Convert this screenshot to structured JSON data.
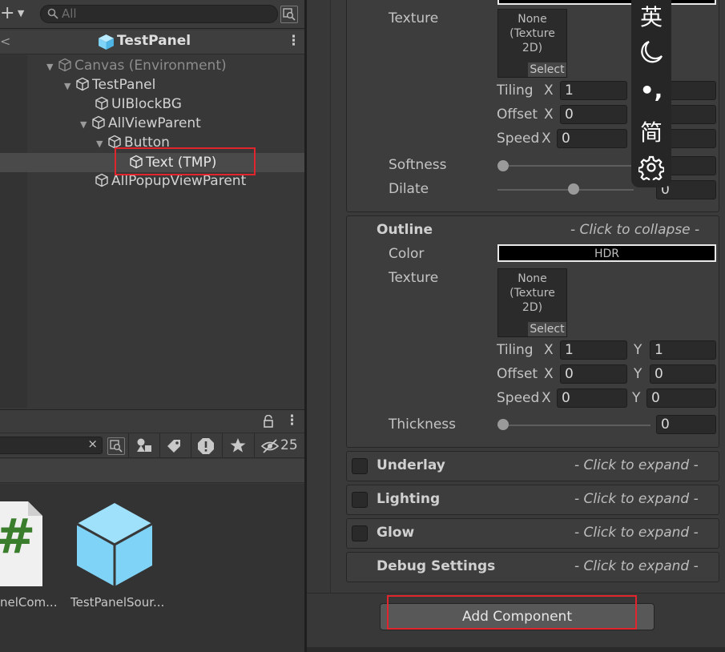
{
  "hierarchy": {
    "search_placeholder": "All",
    "scene_title": "TestPanel",
    "tree": [
      {
        "label": "Canvas (Environment)",
        "dim": true
      },
      {
        "label": "TestPanel"
      },
      {
        "label": "UIBlockBG"
      },
      {
        "label": "AllViewParent"
      },
      {
        "label": "Button"
      },
      {
        "label": "Text (TMP)",
        "selected": true
      },
      {
        "label": "AllPopupViewParent"
      }
    ]
  },
  "project": {
    "hidden_count": "25",
    "assets": [
      {
        "label": "nelCom...",
        "icon": "csharp-script-icon",
        "glyph": "#"
      },
      {
        "label": "TestPanelSour...",
        "icon": "prefab-cube-icon"
      }
    ]
  },
  "inspector": {
    "face": {
      "texture_label": "Texture",
      "texture_none": "None",
      "texture_type": "(Texture",
      "texture_dim": "2D)",
      "select_label": "Select",
      "tiling_label": "Tiling",
      "offset_label": "Offset",
      "speed_label": "Speed",
      "x": "X",
      "tiling_x": "1",
      "offset_x": "0",
      "speed_x": "0",
      "softness_label": "Softness",
      "dilate_label": "Dilate",
      "dilate_value": "0"
    },
    "outline": {
      "title": "Outline",
      "hint": "- Click to collapse -",
      "color_label": "Color",
      "hdr": "HDR",
      "texture_label": "Texture",
      "texture_none": "None",
      "texture_type": "(Texture",
      "texture_dim": "2D)",
      "select_label": "Select",
      "tiling_label": "Tiling",
      "offset_label": "Offset",
      "speed_label": "Speed",
      "x": "X",
      "y": "Y",
      "tiling_x": "1",
      "tiling_y": "1",
      "offset_x": "0",
      "offset_y": "0",
      "speed_x": "0",
      "speed_y": "0",
      "thickness_label": "Thickness",
      "thickness_value": "0"
    },
    "sections": [
      {
        "title": "Underlay",
        "hint": "- Click to expand -",
        "checkbox": true
      },
      {
        "title": "Lighting",
        "hint": "- Click to expand -",
        "checkbox": true
      },
      {
        "title": "Glow",
        "hint": "- Click to expand -",
        "checkbox": true
      },
      {
        "title": "Debug Settings",
        "hint": "- Click to expand -",
        "checkbox": false
      }
    ],
    "add_component": "Add Component"
  },
  "ime_toolbar": {
    "lang": "英",
    "punct": "•,",
    "script": "简"
  },
  "colors": {
    "highlight": "#e0252c",
    "prefab_blue": "#7fd3f7",
    "csharp_green": "#3a7d2c"
  }
}
